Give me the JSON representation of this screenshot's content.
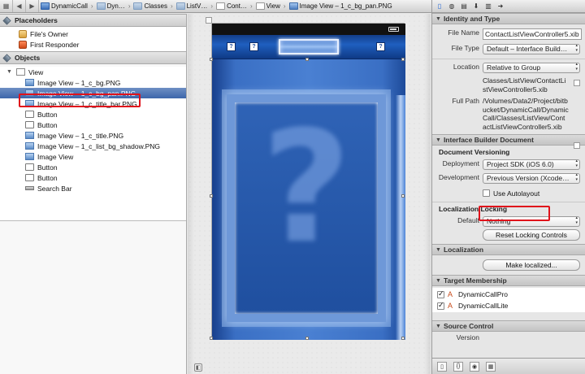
{
  "jumpbar": {
    "crumbs": [
      "DynamicCall",
      "Dyn…",
      "Classes",
      "ListV…",
      "Cont…",
      "View",
      "Image View – 1_c_bg_pan.PNG"
    ]
  },
  "left": {
    "placeholders": {
      "title": "Placeholders",
      "items": [
        "File's Owner",
        "First Responder"
      ]
    },
    "objects": {
      "title": "Objects",
      "root": "View",
      "children": [
        {
          "label": "Image View – 1_c_bg.PNG",
          "icon": "image-view-icon"
        },
        {
          "label": "Image View – 1_c_bg_pan.PNG",
          "icon": "image-view-icon",
          "selected": true
        },
        {
          "label": "Image View – 1_c_title_bar.PNG",
          "icon": "image-view-icon"
        },
        {
          "label": "Button",
          "icon": "button-icon"
        },
        {
          "label": "Button",
          "icon": "button-icon"
        },
        {
          "label": "Image View – 1_c_title.PNG",
          "icon": "image-view-icon"
        },
        {
          "label": "Image View – 1_c_list_bg_shadow.PNG",
          "icon": "image-view-icon"
        },
        {
          "label": "Image View",
          "icon": "image-view-icon"
        },
        {
          "label": "Button",
          "icon": "button-icon"
        },
        {
          "label": "Button",
          "icon": "button-icon"
        },
        {
          "label": "Search Bar",
          "icon": "search-bar-icon"
        }
      ]
    }
  },
  "canvas": {
    "title_buttons": [
      "?",
      "?",
      "?"
    ],
    "big_glyph": "?"
  },
  "inspector": {
    "identity": {
      "title": "Identity and Type",
      "file_name_label": "File Name",
      "file_name": "ContactListViewController5.xib",
      "file_type_label": "File Type",
      "file_type": "Default – Interface Build…",
      "location_label": "Location",
      "location": "Relative to Group",
      "location_path": "Classes/ListView/ContactListViewController5.xib",
      "full_path_label": "Full Path",
      "full_path": "/Volumes/Data2/Project/bitbucket/DynamicCall/DynamicCall/Classes/ListView/ContactListViewController5.xib"
    },
    "ib_document": {
      "title": "Interface Builder Document",
      "versioning_title": "Document Versioning",
      "deployment_label": "Deployment",
      "deployment": "Project SDK (iOS 6.0)",
      "development_label": "Development",
      "development": "Previous Version (Xcode…",
      "autolayout_label": "Use Autolayout",
      "autolayout_checked": false,
      "loc_locking_title": "Localization Locking",
      "default_label": "Default",
      "default_value": "Nothing",
      "reset_button": "Reset Locking Controls"
    },
    "localization": {
      "title": "Localization",
      "button": "Make localized..."
    },
    "target_membership": {
      "title": "Target Membership",
      "targets": [
        {
          "name": "DynamicCallPro",
          "checked": true
        },
        {
          "name": "DynamicCallLite",
          "checked": true
        }
      ]
    },
    "source_control": {
      "title": "Source Control",
      "version_label": "Version"
    }
  }
}
